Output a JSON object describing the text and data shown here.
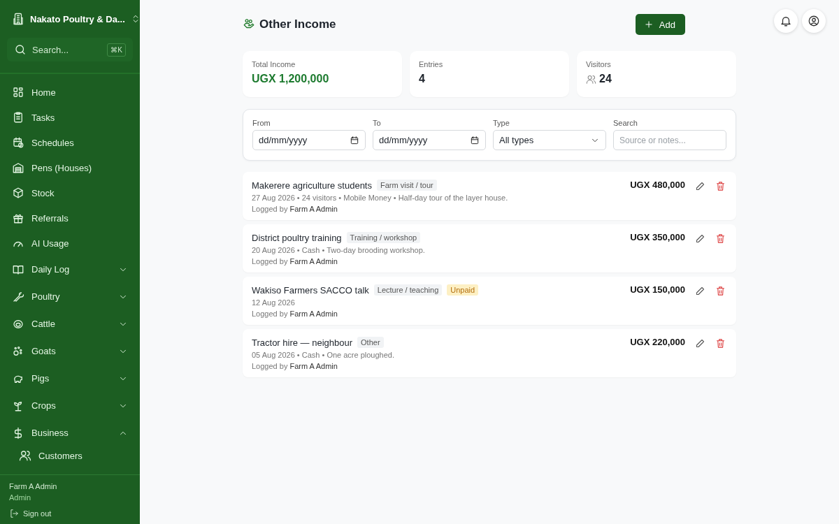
{
  "sidebar": {
    "farm_name": "Nakato Poultry & Da...",
    "search": {
      "placeholder": "Search...",
      "shortcut": "⌘K"
    },
    "items": [
      {
        "label": "Home",
        "kind": "link"
      },
      {
        "label": "Tasks",
        "kind": "link"
      },
      {
        "label": "Schedules",
        "kind": "link"
      },
      {
        "label": "Pens (Houses)",
        "kind": "link"
      },
      {
        "label": "Stock",
        "kind": "link"
      },
      {
        "label": "Referrals",
        "kind": "link"
      },
      {
        "label": "AI Usage",
        "kind": "link"
      },
      {
        "label": "Daily Log",
        "kind": "group",
        "expanded": false
      },
      {
        "label": "Poultry",
        "kind": "group",
        "expanded": false
      },
      {
        "label": "Cattle",
        "kind": "group",
        "expanded": false
      },
      {
        "label": "Goats",
        "kind": "group",
        "expanded": false
      },
      {
        "label": "Pigs",
        "kind": "group",
        "expanded": false
      },
      {
        "label": "Crops",
        "kind": "group",
        "expanded": false
      },
      {
        "label": "Business",
        "kind": "group",
        "expanded": true,
        "children": [
          {
            "label": "Customers"
          }
        ]
      }
    ],
    "user": {
      "name": "Farm A Admin",
      "role": "Admin"
    },
    "sign_out": "Sign out"
  },
  "page": {
    "title": "Other Income",
    "add_button": "Add"
  },
  "stats": [
    {
      "label": "Total Income",
      "value": "UGX 1,200,000",
      "kind": "money"
    },
    {
      "label": "Entries",
      "value": "4",
      "kind": "plain"
    },
    {
      "label": "Visitors",
      "value": "24",
      "kind": "people"
    }
  ],
  "filters": {
    "from": {
      "label": "From",
      "value": "dd/mm/yyyy"
    },
    "to": {
      "label": "To",
      "value": "dd/mm/yyyy"
    },
    "type": {
      "label": "Type",
      "value": "All types"
    },
    "search": {
      "label": "Search",
      "placeholder": "Source or notes..."
    }
  },
  "entries": [
    {
      "title": "Makerere agriculture students",
      "tags": [
        {
          "label": "Farm visit / tour",
          "kind": "category"
        }
      ],
      "meta": "27 Aug 2026 • 24 visitors • Mobile Money • Half-day tour of the layer house.",
      "logged_by": "Logged by",
      "logger": "Farm A Admin",
      "amount": "UGX 480,000"
    },
    {
      "title": "District poultry training",
      "tags": [
        {
          "label": "Training / workshop",
          "kind": "category"
        }
      ],
      "meta": "20 Aug 2026 • Cash • Two-day brooding workshop.",
      "logged_by": "Logged by",
      "logger": "Farm A Admin",
      "amount": "UGX 350,000"
    },
    {
      "title": "Wakiso Farmers SACCO talk",
      "tags": [
        {
          "label": "Lecture / teaching",
          "kind": "category"
        },
        {
          "label": "Unpaid",
          "kind": "status"
        }
      ],
      "meta": "12 Aug 2026",
      "logged_by": "Logged by",
      "logger": "Farm A Admin",
      "amount": "UGX 150,000"
    },
    {
      "title": "Tractor hire — neighbour",
      "tags": [
        {
          "label": "Other",
          "kind": "category"
        }
      ],
      "meta": "05 Aug 2026 • Cash • One acre ploughed.",
      "logged_by": "Logged by",
      "logger": "Farm A Admin",
      "amount": "UGX 220,000"
    }
  ]
}
